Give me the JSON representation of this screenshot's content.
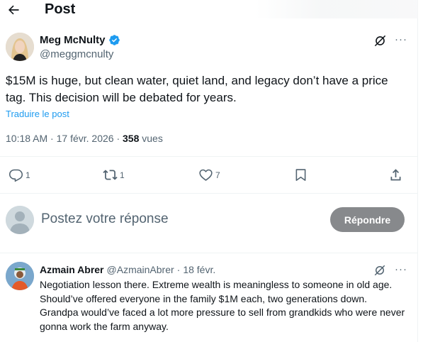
{
  "header": {
    "title": "Post"
  },
  "post": {
    "author_name": "Meg McNulty",
    "author_handle": "@meggmcnulty",
    "text": "$15M is huge, but clean water, quiet land, and legacy don’t have a price tag. This decision will be debated for years.",
    "translate_label": "Traduire le post",
    "time": "10:18 AM",
    "date": "17 févr. 2026",
    "views_count": "358",
    "views_label": "vues",
    "replies": "1",
    "reposts": "1",
    "likes": "7",
    "more_glyph": "···"
  },
  "reply_box": {
    "placeholder": "Postez votre réponse",
    "button_label": "Répondre"
  },
  "comments": [
    {
      "author_name": "Azmain Abrer",
      "author_handle": "@AzmainAbrer",
      "separator": "·",
      "date": "18 févr.",
      "text": "Negotiation lesson there. Extreme wealth is meaningless to someone in old age. Should’ve offered everyone in the family $1M each, two generations down. Grandpa would’ve faced a lot more pressure to sell from grandkids who were never gonna work the farm anyway.",
      "more_glyph": "···"
    }
  ],
  "icons": [
    "back-arrow-icon",
    "verified-badge-icon",
    "grok-icon",
    "more-icon",
    "reply-icon",
    "repost-icon",
    "like-icon",
    "bookmark-icon",
    "share-icon"
  ],
  "colors": {
    "accent": "#1d9bf0",
    "secondary_text": "#536471",
    "button": "#87898c"
  }
}
